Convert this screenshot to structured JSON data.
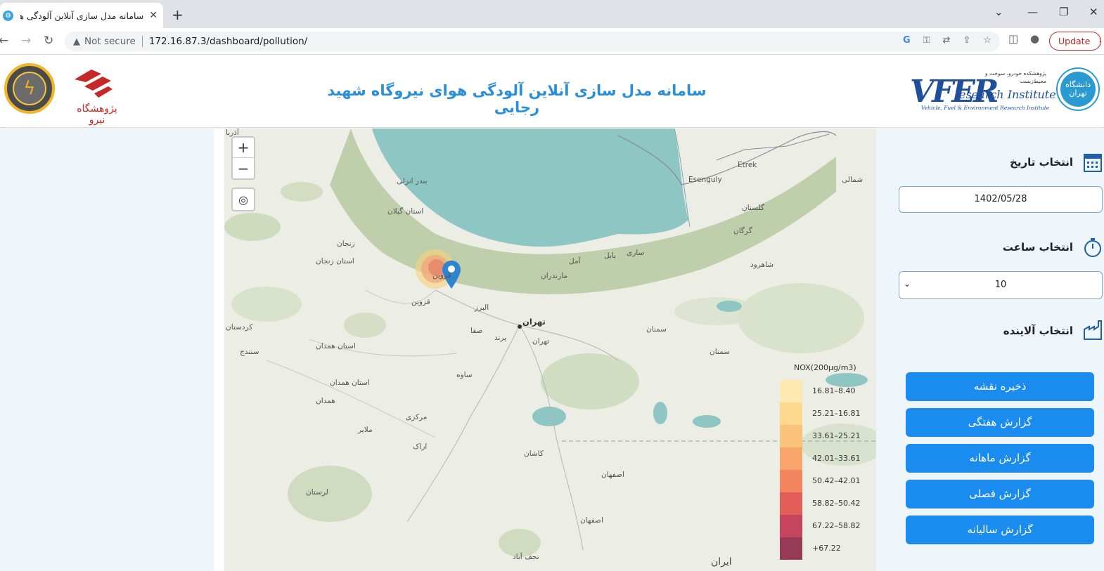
{
  "browser": {
    "tab_title": "سامانه مدل سازی آنلاین آلودگی هو",
    "new_tab": "+",
    "security_label": "Not secure",
    "url": "172.16.87.3/dashboard/pollution/",
    "update_label": "Update"
  },
  "header": {
    "title": "سامانه مدل سازی آنلاین آلودگی هوای نیروگاه شهید رجایی",
    "niroo_logo_text": "پژوهشگاه نیرو",
    "vfer_logo_text": "VFER",
    "vfer_logo_sub": "esearch Institute",
    "vfer_logo_caption": "Vehicle, Fuel & Environment Research Institute",
    "vfer_logo_fa": "پژوهشکده خودرو، سوخت و محیط‌زیست",
    "ut_logo_text": "دانشگاه تهران"
  },
  "map": {
    "zoom_in": "+",
    "zoom_out": "−",
    "places": {
      "azarbaijan": "آذربا",
      "bandar_anzali": "بندر انزلی",
      "gilan": "استان گیلان",
      "zanjan": "زنجان",
      "zanjan_prov": "استان زنجان",
      "qazvin_city": "قزوین",
      "qazvin": "قزوین",
      "alborz": "البرز",
      "tehran": "تهران",
      "tehran_prov": "تهران",
      "saqa": "صفا",
      "parand": "پرند",
      "kordestan": "کردستان",
      "sanandaj": "سنندج",
      "hamadan_prov": "استان همدان",
      "hamadan_prov2": "استان همدان",
      "hamadan": "همدان",
      "saveh": "ساوه",
      "markazi": "مرکزی",
      "malayer": "ملایر",
      "arak": "اراک",
      "kashan": "کاشان",
      "esfahan": "اصفهان",
      "esfahan_prov": "اصفهان",
      "lorestan": "لرستان",
      "najafabad": "نجف آباد",
      "iran": "ایران",
      "mazandaran": "مازندران",
      "amol": "آمل",
      "babol": "بابل",
      "sari": "ساری",
      "gorgan": "گرگان",
      "golestan": "گلستان",
      "shahroud": "شاهرود",
      "semnan": "سمنان",
      "semnan_prov": "سمنان",
      "esenguly": "Esenguly",
      "etrek": "Etrek",
      "shomali": "شمالی"
    },
    "legend": {
      "title": "NOX(200μg/m3)",
      "rows": [
        {
          "label": "16.81–8.40",
          "color": "#fde9b0"
        },
        {
          "label": "25.21–16.81",
          "color": "#fcd98f"
        },
        {
          "label": "33.61–25.21",
          "color": "#fbc27a"
        },
        {
          "label": "42.01–33.61",
          "color": "#f8a66b"
        },
        {
          "label": "50.42–42.01",
          "color": "#f3855f"
        },
        {
          "label": "58.82–50.42",
          "color": "#e35e58"
        },
        {
          "label": "67.22–58.82",
          "color": "#c4455c"
        },
        {
          "label": "+67.22",
          "color": "#973a58"
        }
      ]
    }
  },
  "sidebar": {
    "date_label": "انتخاب تاریخ",
    "date_value": "1402/05/28",
    "hour_label": "انتخاب ساعت",
    "hour_value": "10",
    "pollutant_label": "انتخاب آلاینده",
    "buttons": {
      "save_map": "ذخیره نقشه",
      "weekly": "گزارش هفتگی",
      "monthly": "گزارش ماهانه",
      "seasonal": "گزارش فصلی",
      "yearly": "گزارش سالیانه"
    }
  }
}
